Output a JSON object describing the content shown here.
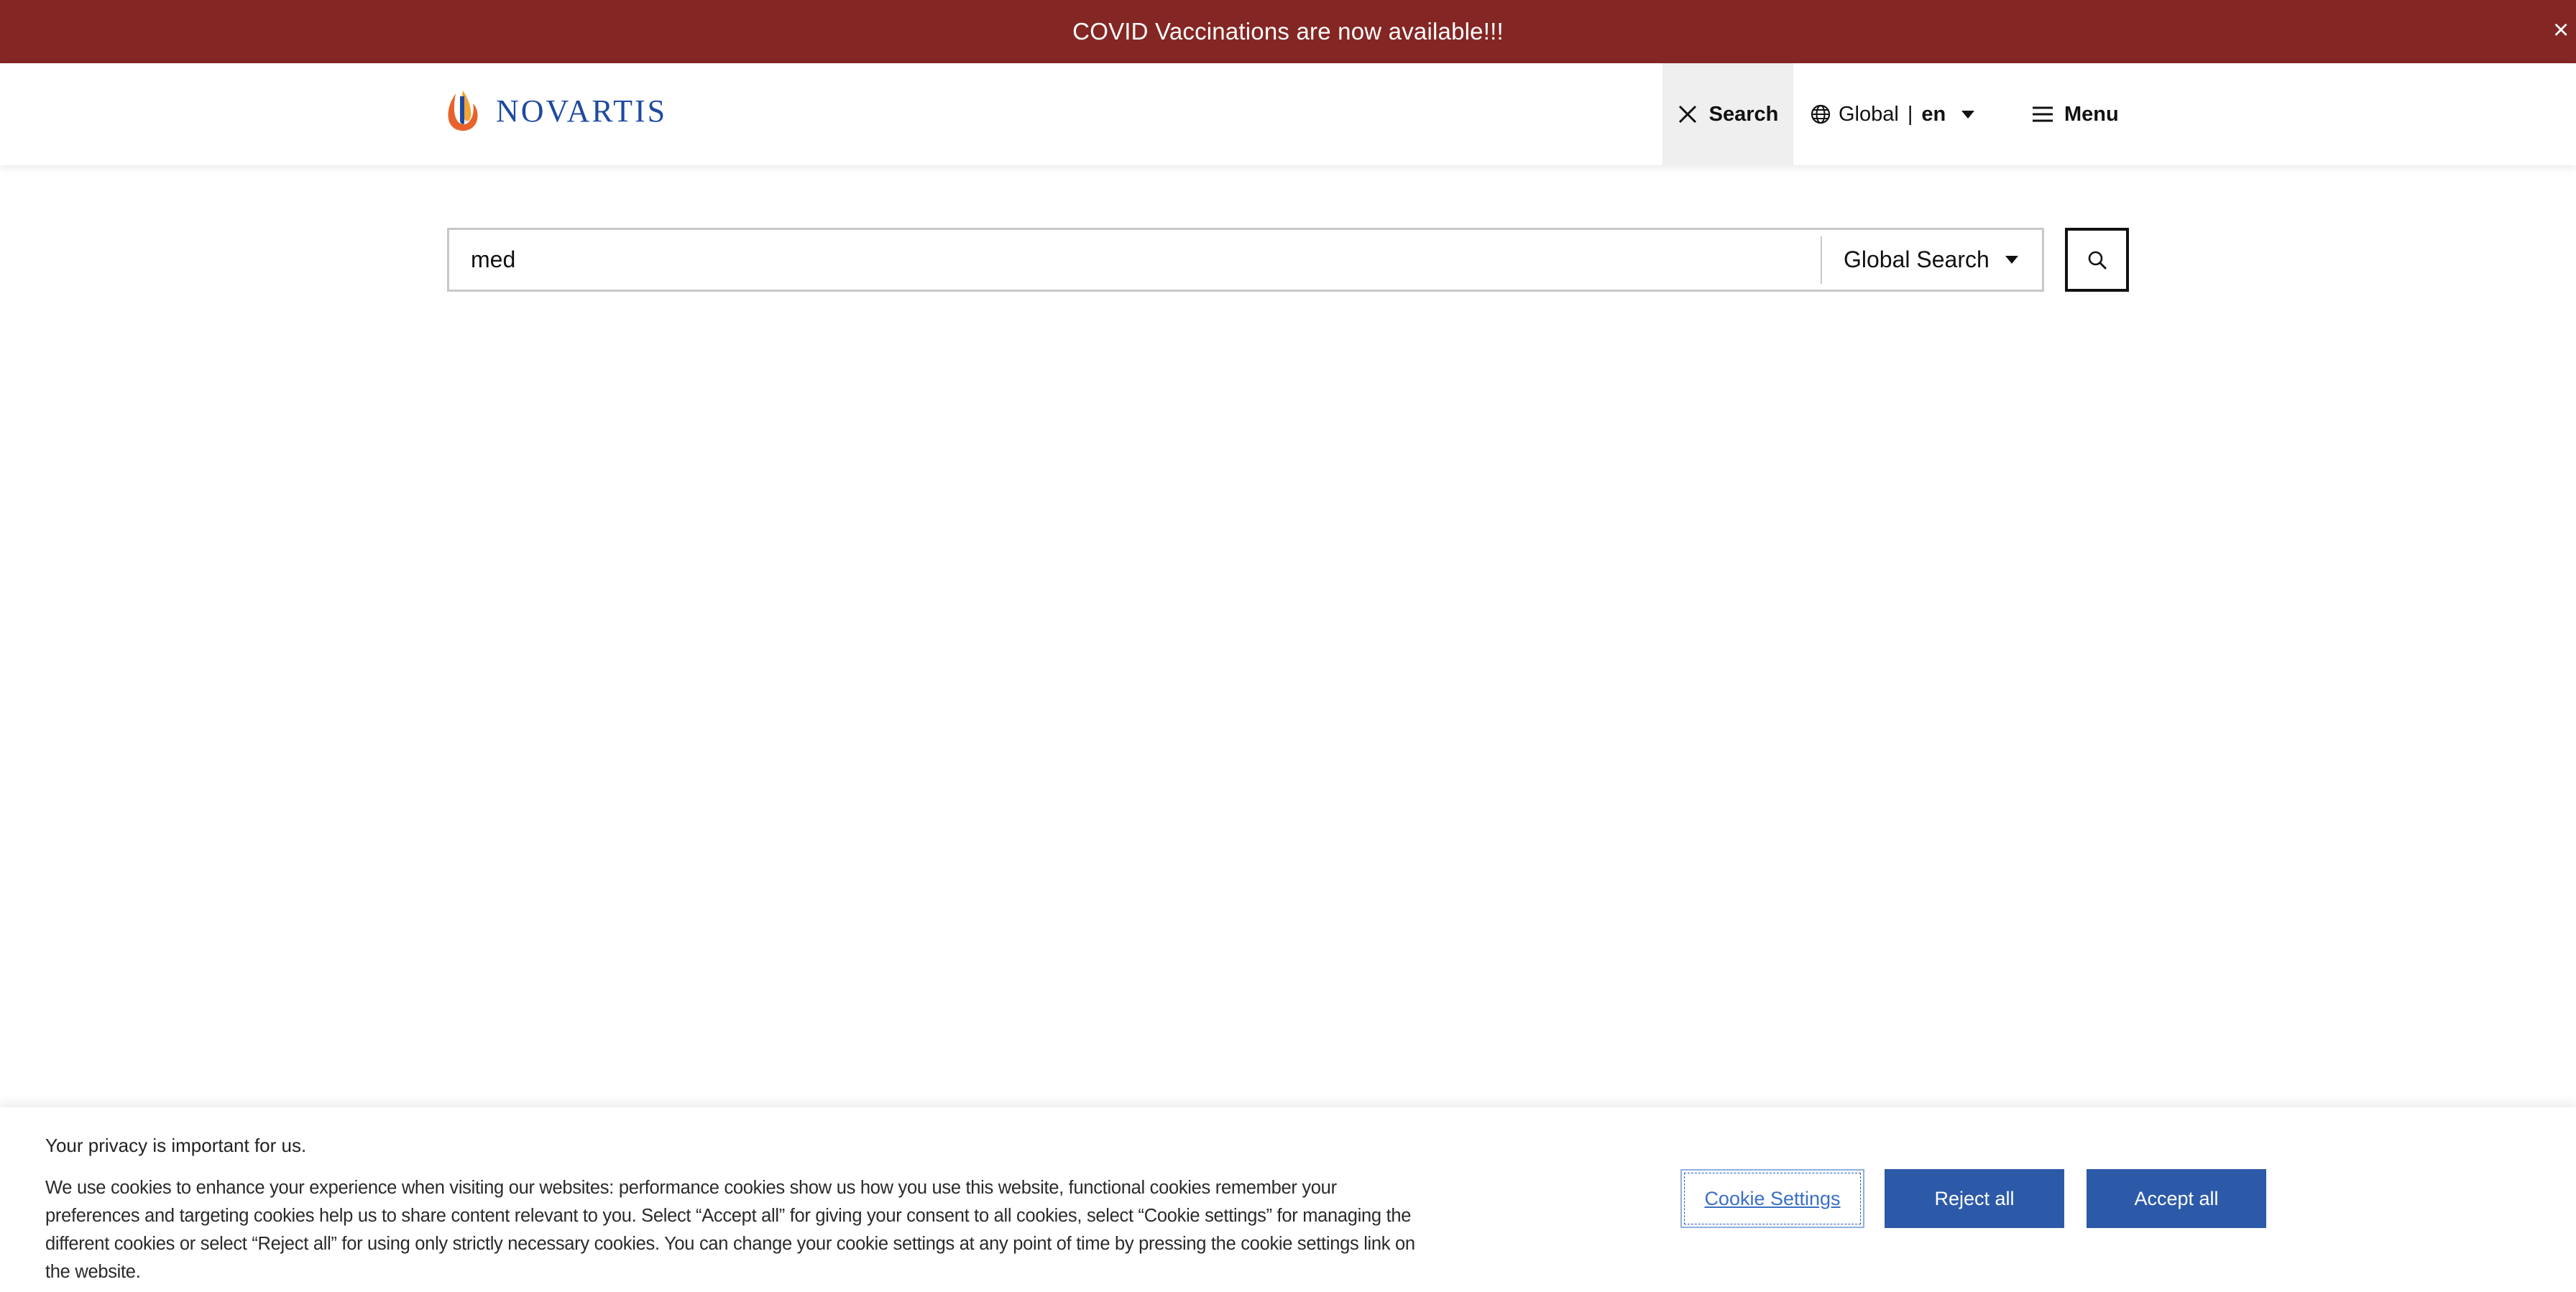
{
  "announcement": {
    "text": "COVID Vaccinations are now available!!!",
    "close_glyph": "×"
  },
  "header": {
    "logo_text": "NOVARTIS",
    "search_toggle_label": "Search",
    "language": {
      "region": "Global",
      "separator": "|",
      "code": "en"
    },
    "menu_label": "Menu"
  },
  "search": {
    "value": "med",
    "scope": "Global Search"
  },
  "cookie_banner": {
    "title": "Your privacy is important for us.",
    "body": "We use cookies to enhance your experience when visiting our websites: performance cookies show us how you use this website, functional cookies remember your preferences and targeting cookies help us to share content relevant to you. Select “Accept all” for giving your consent to all cookies, select “Cookie settings” for managing the different cookies or select “Reject all” for using only strictly necessary cookies. You can change your cookie settings at any point of time by pressing the cookie settings link on the website.",
    "settings_label": "Cookie Settings",
    "reject_label": "Reject all",
    "accept_label": "Accept all"
  },
  "colors": {
    "banner_bg": "#842623",
    "brand_blue": "#1f4aa0",
    "button_blue": "#2d5aa8",
    "active_tab_bg": "#efefef"
  },
  "icons": {
    "close": "close-icon",
    "globe": "globe-icon",
    "hamburger": "hamburger-icon",
    "search": "search-icon",
    "caret": "caret-down-icon"
  }
}
